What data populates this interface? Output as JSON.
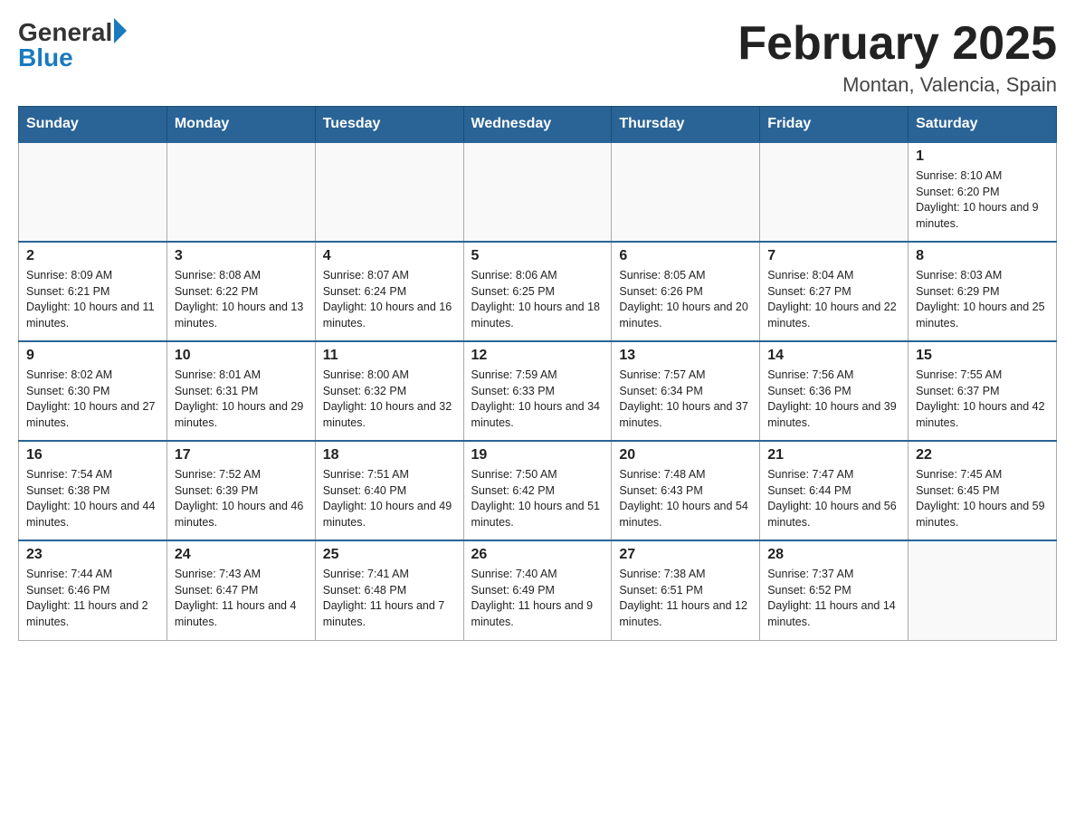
{
  "header": {
    "logo_general": "General",
    "logo_blue": "Blue",
    "month_title": "February 2025",
    "location": "Montan, Valencia, Spain"
  },
  "weekdays": [
    "Sunday",
    "Monday",
    "Tuesday",
    "Wednesday",
    "Thursday",
    "Friday",
    "Saturday"
  ],
  "weeks": [
    [
      {
        "day": "",
        "info": ""
      },
      {
        "day": "",
        "info": ""
      },
      {
        "day": "",
        "info": ""
      },
      {
        "day": "",
        "info": ""
      },
      {
        "day": "",
        "info": ""
      },
      {
        "day": "",
        "info": ""
      },
      {
        "day": "1",
        "info": "Sunrise: 8:10 AM\nSunset: 6:20 PM\nDaylight: 10 hours and 9 minutes."
      }
    ],
    [
      {
        "day": "2",
        "info": "Sunrise: 8:09 AM\nSunset: 6:21 PM\nDaylight: 10 hours and 11 minutes."
      },
      {
        "day": "3",
        "info": "Sunrise: 8:08 AM\nSunset: 6:22 PM\nDaylight: 10 hours and 13 minutes."
      },
      {
        "day": "4",
        "info": "Sunrise: 8:07 AM\nSunset: 6:24 PM\nDaylight: 10 hours and 16 minutes."
      },
      {
        "day": "5",
        "info": "Sunrise: 8:06 AM\nSunset: 6:25 PM\nDaylight: 10 hours and 18 minutes."
      },
      {
        "day": "6",
        "info": "Sunrise: 8:05 AM\nSunset: 6:26 PM\nDaylight: 10 hours and 20 minutes."
      },
      {
        "day": "7",
        "info": "Sunrise: 8:04 AM\nSunset: 6:27 PM\nDaylight: 10 hours and 22 minutes."
      },
      {
        "day": "8",
        "info": "Sunrise: 8:03 AM\nSunset: 6:29 PM\nDaylight: 10 hours and 25 minutes."
      }
    ],
    [
      {
        "day": "9",
        "info": "Sunrise: 8:02 AM\nSunset: 6:30 PM\nDaylight: 10 hours and 27 minutes."
      },
      {
        "day": "10",
        "info": "Sunrise: 8:01 AM\nSunset: 6:31 PM\nDaylight: 10 hours and 29 minutes."
      },
      {
        "day": "11",
        "info": "Sunrise: 8:00 AM\nSunset: 6:32 PM\nDaylight: 10 hours and 32 minutes."
      },
      {
        "day": "12",
        "info": "Sunrise: 7:59 AM\nSunset: 6:33 PM\nDaylight: 10 hours and 34 minutes."
      },
      {
        "day": "13",
        "info": "Sunrise: 7:57 AM\nSunset: 6:34 PM\nDaylight: 10 hours and 37 minutes."
      },
      {
        "day": "14",
        "info": "Sunrise: 7:56 AM\nSunset: 6:36 PM\nDaylight: 10 hours and 39 minutes."
      },
      {
        "day": "15",
        "info": "Sunrise: 7:55 AM\nSunset: 6:37 PM\nDaylight: 10 hours and 42 minutes."
      }
    ],
    [
      {
        "day": "16",
        "info": "Sunrise: 7:54 AM\nSunset: 6:38 PM\nDaylight: 10 hours and 44 minutes."
      },
      {
        "day": "17",
        "info": "Sunrise: 7:52 AM\nSunset: 6:39 PM\nDaylight: 10 hours and 46 minutes."
      },
      {
        "day": "18",
        "info": "Sunrise: 7:51 AM\nSunset: 6:40 PM\nDaylight: 10 hours and 49 minutes."
      },
      {
        "day": "19",
        "info": "Sunrise: 7:50 AM\nSunset: 6:42 PM\nDaylight: 10 hours and 51 minutes."
      },
      {
        "day": "20",
        "info": "Sunrise: 7:48 AM\nSunset: 6:43 PM\nDaylight: 10 hours and 54 minutes."
      },
      {
        "day": "21",
        "info": "Sunrise: 7:47 AM\nSunset: 6:44 PM\nDaylight: 10 hours and 56 minutes."
      },
      {
        "day": "22",
        "info": "Sunrise: 7:45 AM\nSunset: 6:45 PM\nDaylight: 10 hours and 59 minutes."
      }
    ],
    [
      {
        "day": "23",
        "info": "Sunrise: 7:44 AM\nSunset: 6:46 PM\nDaylight: 11 hours and 2 minutes."
      },
      {
        "day": "24",
        "info": "Sunrise: 7:43 AM\nSunset: 6:47 PM\nDaylight: 11 hours and 4 minutes."
      },
      {
        "day": "25",
        "info": "Sunrise: 7:41 AM\nSunset: 6:48 PM\nDaylight: 11 hours and 7 minutes."
      },
      {
        "day": "26",
        "info": "Sunrise: 7:40 AM\nSunset: 6:49 PM\nDaylight: 11 hours and 9 minutes."
      },
      {
        "day": "27",
        "info": "Sunrise: 7:38 AM\nSunset: 6:51 PM\nDaylight: 11 hours and 12 minutes."
      },
      {
        "day": "28",
        "info": "Sunrise: 7:37 AM\nSunset: 6:52 PM\nDaylight: 11 hours and 14 minutes."
      },
      {
        "day": "",
        "info": ""
      }
    ]
  ]
}
